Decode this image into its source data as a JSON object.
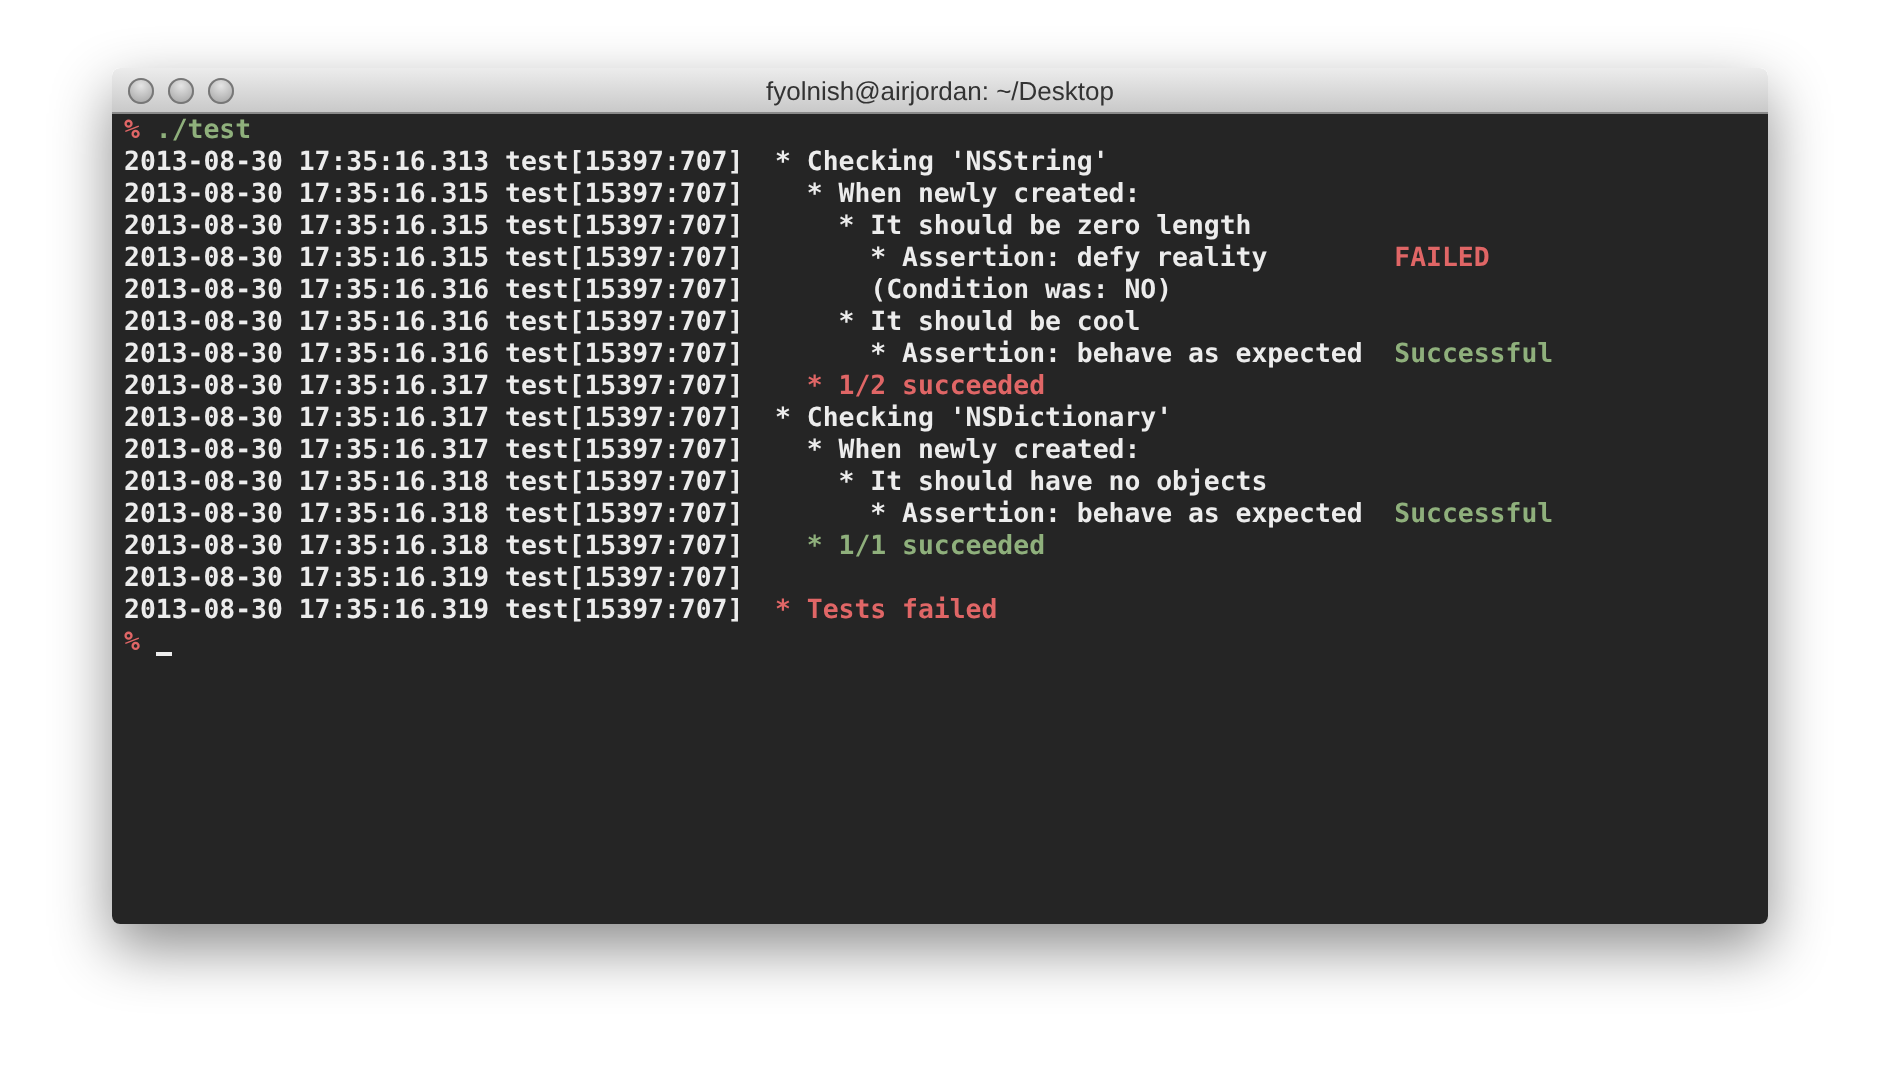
{
  "window": {
    "title": "fyolnish@airjordan: ~/Desktop"
  },
  "terminal": {
    "lines": [
      {
        "kind": "prompt",
        "prompt": "%",
        "command": "./test"
      },
      {
        "kind": "log",
        "prefix": "2013-08-30 17:35:16.313 test[15397:707]",
        "message": "* Checking 'NSString'",
        "color": "#ececec"
      },
      {
        "kind": "log",
        "prefix": "2013-08-30 17:35:16.315 test[15397:707]",
        "message": "  * When newly created:",
        "color": "#ececec"
      },
      {
        "kind": "log",
        "prefix": "2013-08-30 17:35:16.315 test[15397:707]",
        "message": "    * It should be zero length",
        "color": "#ececec"
      },
      {
        "kind": "log",
        "prefix": "2013-08-30 17:35:16.315 test[15397:707]",
        "message": "      * Assertion: defy reality",
        "color": "#ececec",
        "result": {
          "text": "FAILED",
          "color": "#e06666"
        }
      },
      {
        "kind": "log",
        "prefix": "2013-08-30 17:35:16.316 test[15397:707]",
        "message": "      (Condition was: NO)",
        "color": "#ececec"
      },
      {
        "kind": "log",
        "prefix": "2013-08-30 17:35:16.316 test[15397:707]",
        "message": "    * It should be cool",
        "color": "#ececec"
      },
      {
        "kind": "log",
        "prefix": "2013-08-30 17:35:16.316 test[15397:707]",
        "message": "      * Assertion: behave as expected",
        "color": "#ececec",
        "result": {
          "text": "Successful",
          "color": "#8fb07c"
        }
      },
      {
        "kind": "log",
        "prefix": "2013-08-30 17:35:16.317 test[15397:707]",
        "message": "  * 1/2 succeeded",
        "color": "#e06666"
      },
      {
        "kind": "log",
        "prefix": "2013-08-30 17:35:16.317 test[15397:707]",
        "message": "* Checking 'NSDictionary'",
        "color": "#ececec"
      },
      {
        "kind": "log",
        "prefix": "2013-08-30 17:35:16.317 test[15397:707]",
        "message": "  * When newly created:",
        "color": "#ececec"
      },
      {
        "kind": "log",
        "prefix": "2013-08-30 17:35:16.318 test[15397:707]",
        "message": "    * It should have no objects",
        "color": "#ececec"
      },
      {
        "kind": "log",
        "prefix": "2013-08-30 17:35:16.318 test[15397:707]",
        "message": "      * Assertion: behave as expected",
        "color": "#ececec",
        "result": {
          "text": "Successful",
          "color": "#8fb07c"
        }
      },
      {
        "kind": "log",
        "prefix": "2013-08-30 17:35:16.318 test[15397:707]",
        "message": "  * 1/1 succeeded",
        "color": "#8fb07c"
      },
      {
        "kind": "log",
        "prefix": "2013-08-30 17:35:16.319 test[15397:707]"
      },
      {
        "kind": "log",
        "prefix": "2013-08-30 17:35:16.319 test[15397:707]",
        "message": "* Tests failed",
        "color": "#e06666"
      },
      {
        "kind": "prompt",
        "prompt": "%",
        "cursor": true
      }
    ]
  }
}
